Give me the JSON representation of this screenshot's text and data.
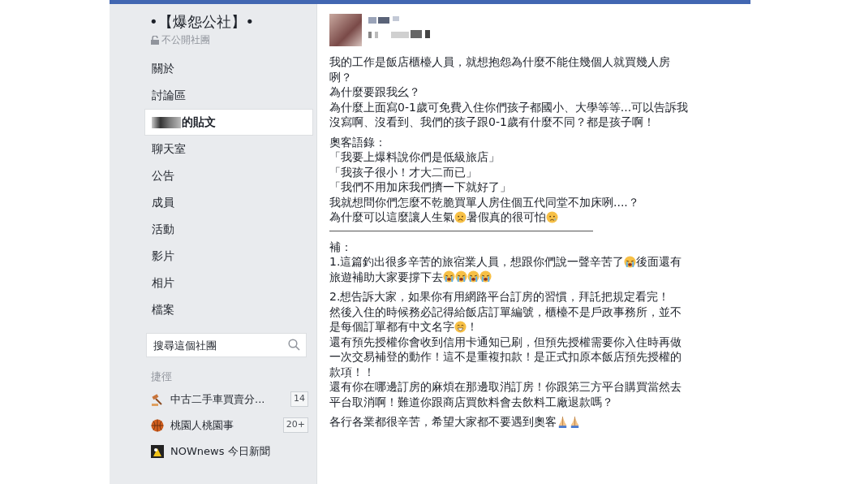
{
  "group": {
    "name": "•【爆怨公社】•",
    "privacy": "不公開社團"
  },
  "nav": [
    {
      "label": "關於",
      "selected": false
    },
    {
      "label": "討論區",
      "selected": false
    },
    {
      "label": "的貼文",
      "selected": true,
      "redacted": true
    },
    {
      "label": "聊天室",
      "selected": false
    },
    {
      "label": "公告",
      "selected": false
    },
    {
      "label": "成員",
      "selected": false
    },
    {
      "label": "活動",
      "selected": false
    },
    {
      "label": "影片",
      "selected": false
    },
    {
      "label": "相片",
      "selected": false
    },
    {
      "label": "檔案",
      "selected": false
    }
  ],
  "search": {
    "placeholder": "搜尋這個社團"
  },
  "shortcuts": {
    "heading": "捷徑",
    "items": [
      {
        "kind": "gavel",
        "name": "中古二手車買賣分...",
        "count": "14"
      },
      {
        "kind": "basketball",
        "name": "桃園人桃園事",
        "count": "20+"
      },
      {
        "kind": "news",
        "name": "NOWnews 今日新聞"
      }
    ]
  },
  "post": {
    "paragraphs": [
      {
        "lines": [
          [
            "我的工作是飯店櫃檯人員，就想抱怨為什麼不能住幾個人就買幾人房"
          ],
          [
            "咧？"
          ],
          [
            "為什麼要跟我幺？"
          ],
          [
            "為什麼上面寫0-1歲可免費入住你們孩子都國小、大學等等...可以告訴我"
          ],
          [
            "沒寫啊、沒看到、我們的孩子跟0-1歲有什麼不同？都是孩子啊！"
          ]
        ]
      },
      {
        "lines": [
          [
            "奧客語錄："
          ],
          [
            "「我要上爆料說你們是低級旅店」"
          ],
          [
            "「我孩子很小！才大二而已」"
          ],
          [
            "「我們不用加床我們擠一下就好了」"
          ],
          [
            "我就想問你們怎麼不乾脆買單人房住個五代同堂不加床咧....？"
          ],
          [
            "為什麼可以這麼讓人生氣",
            {
              "kind": "frown"
            },
            "暑假真的很可怕",
            {
              "kind": "tear"
            }
          ]
        ],
        "rule_after": true
      },
      {
        "lines": [
          [
            "補："
          ],
          [
            "1.這篇釣出很多辛苦的旅宿業人員，想跟你們說一聲辛苦了",
            {
              "kind": "crying"
            },
            "後面還有"
          ],
          [
            "旅遊補助大家要撐下去",
            {
              "kind": "crying"
            },
            {
              "kind": "crying"
            },
            {
              "kind": "crying"
            },
            {
              "kind": "crying"
            }
          ]
        ]
      },
      {
        "lines": [
          [
            "2.想告訴大家，如果你有用網路平台訂房的習慣，拜託把規定看完！"
          ],
          [
            "然後入住的時候務必記得給飯店訂單編號，櫃檯不是戶政事務所，並不"
          ],
          [
            "是每個訂單都有中文名字",
            {
              "kind": "grin"
            },
            "！"
          ],
          [
            "還有預先授權你會收到信用卡通知已刷，但預先授權需要你入住時再做"
          ],
          [
            "一次交易補登的動作！這不是重複扣款！是正式扣原本飯店預先授權的"
          ],
          [
            "款項！！"
          ],
          [
            "還有你在哪邊訂房的麻煩在那邊取消訂房！你跟第三方平台購買當然去"
          ],
          [
            "平台取消啊！難道你跟商店買飲料會去飲料工廠退款嗎？"
          ]
        ]
      },
      {
        "lines": [
          [
            "各行各業都很辛苦，希望大家都不要遇到奧客",
            {
              "kind": "pray"
            },
            {
              "kind": "pray"
            }
          ]
        ]
      }
    ]
  }
}
